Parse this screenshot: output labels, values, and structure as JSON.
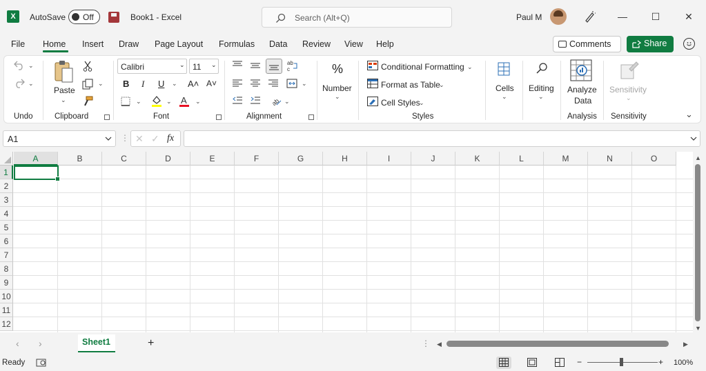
{
  "titlebar": {
    "app_icon": "excel-logo",
    "app_letter": "X",
    "autosave_label": "AutoSave",
    "autosave_state": "Off",
    "save_icon": "save-icon",
    "doc_title": "Book1  -  Excel",
    "search_placeholder": "Search (Alt+Q)",
    "user_name": "Paul M",
    "minimize": "—",
    "maximize": "☐",
    "close": "✕"
  },
  "menu": {
    "tabs": [
      "File",
      "Home",
      "Insert",
      "Draw",
      "Page Layout",
      "Formulas",
      "Data",
      "Review",
      "View",
      "Help"
    ],
    "active_tab": "Home",
    "comments_label": "Comments",
    "share_label": "Share",
    "accent_color": "#107c41"
  },
  "ribbon": {
    "groups": {
      "undo": "Undo",
      "clipboard": "Clipboard",
      "font": "Font",
      "alignment": "Alignment",
      "styles": "Styles",
      "analysis": "Analysis",
      "sensitivity": "Sensitivity"
    },
    "paste_label": "Paste",
    "font_name": "Calibri",
    "font_size": "11",
    "bold": "B",
    "italic": "I",
    "underline": "U",
    "grow_font": "A˄",
    "shrink_font": "A˅",
    "fill_color": "#ffff00",
    "font_color": "#e81123",
    "number_symbol": "%",
    "number_label": "Number",
    "conditional_formatting": "Conditional Formatting",
    "format_as_table": "Format as Table",
    "cell_styles": "Cell Styles",
    "cells_label": "Cells",
    "editing_label": "Editing",
    "analyze_data_line1": "Analyze",
    "analyze_data_line2": "Data",
    "sensitivity_label": "Sensitivity"
  },
  "formula_bar": {
    "name_box": "A1",
    "fx": "fx",
    "formula": ""
  },
  "grid": {
    "columns": [
      "A",
      "B",
      "C",
      "D",
      "E",
      "F",
      "G",
      "H",
      "I",
      "J",
      "K",
      "L",
      "M",
      "N",
      "O"
    ],
    "rows": [
      "1",
      "2",
      "3",
      "4",
      "5",
      "6",
      "7",
      "8",
      "9",
      "10",
      "11",
      "12"
    ],
    "selected_cell": "A1"
  },
  "sheets": {
    "tabs": [
      "Sheet1"
    ],
    "active": "Sheet1",
    "add_sheet": "+"
  },
  "status": {
    "ready": "Ready",
    "zoom": "100%",
    "zoom_minus": "−",
    "zoom_plus": "+"
  }
}
